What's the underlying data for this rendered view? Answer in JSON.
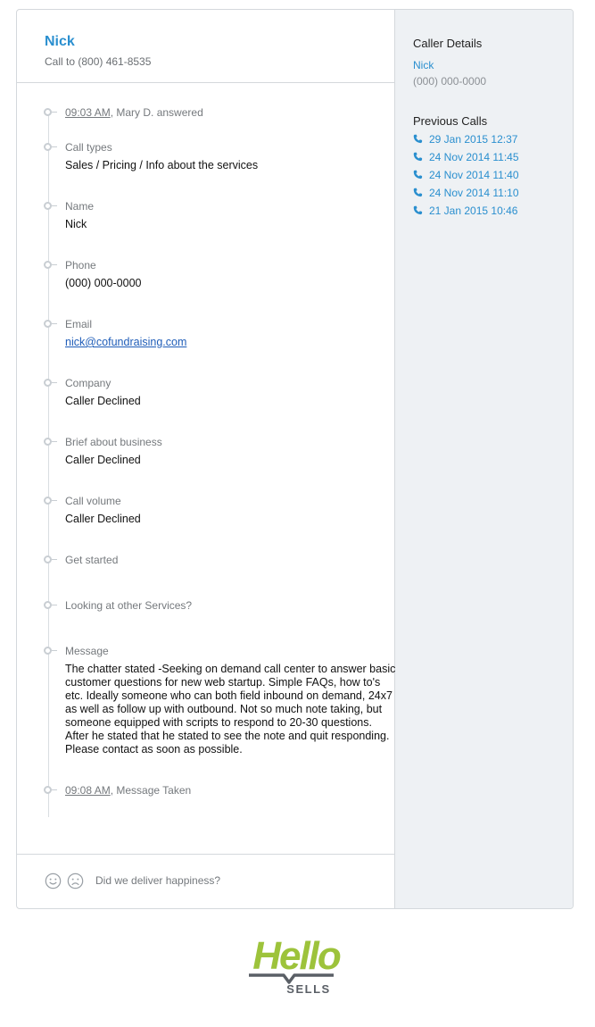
{
  "header": {
    "name": "Nick",
    "call_to": "Call to (800) 461-8535"
  },
  "timeline": {
    "answered_time": "09:03 AM",
    "answered_text": ", Mary D. answered",
    "fields": [
      {
        "label": "Call types",
        "value": "Sales / Pricing / Info about the services"
      },
      {
        "label": "Name",
        "value": "Nick"
      },
      {
        "label": "Phone",
        "value": "(000) 000-0000"
      },
      {
        "label": "Email",
        "value": "nick@cofundraising.com"
      },
      {
        "label": "Company",
        "value": "Caller Declined"
      },
      {
        "label": "Brief about business",
        "value": "Caller Declined"
      },
      {
        "label": "Call volume",
        "value": "Caller Declined"
      },
      {
        "label": "Get started",
        "value": ""
      },
      {
        "label": "Looking at other Services?",
        "value": ""
      },
      {
        "label": "Message",
        "value": "The chatter stated -Seeking on demand call center to answer basic customer questions for new web startup. Simple FAQs, how to's etc. Ideally someone who can both field inbound on demand, 24x7 as well as follow up with outbound. Not so much note taking, but someone equipped with scripts to respond to 20-30 questions. After he stated that he stated to see the note and quit responding. Please contact as soon as possible."
      }
    ],
    "taken_time": "09:08 AM",
    "taken_text": ", Message Taken"
  },
  "feedback": {
    "question": "Did we deliver happiness?"
  },
  "sidebar": {
    "caller_details_title": "Caller Details",
    "caller_name": "Nick",
    "caller_phone": "(000) 000-0000",
    "previous_calls_title": "Previous Calls",
    "previous_calls": [
      "29 Jan 2015 12:37",
      "24 Nov 2014 11:45",
      "24 Nov 2014 11:40",
      "24 Nov 2014 11:10",
      "21 Jan 2015 10:46"
    ]
  },
  "logo": {
    "word": "Hello",
    "sub": "SELLS"
  },
  "colors": {
    "accent": "#2a8fcf",
    "logo_green": "#9dc33b",
    "logo_gray": "#5a5f66"
  }
}
